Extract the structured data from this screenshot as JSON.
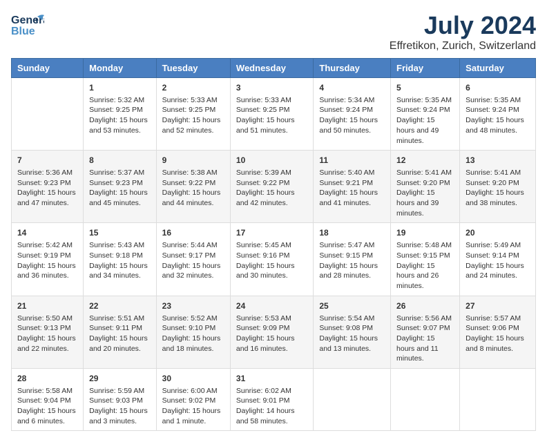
{
  "logo": {
    "line1": "General",
    "line2": "Blue"
  },
  "title": "July 2024",
  "subtitle": "Effretikon, Zurich, Switzerland",
  "days_of_week": [
    "Sunday",
    "Monday",
    "Tuesday",
    "Wednesday",
    "Thursday",
    "Friday",
    "Saturday"
  ],
  "weeks": [
    [
      {
        "day": "",
        "sunrise": "",
        "sunset": "",
        "daylight": ""
      },
      {
        "day": "1",
        "sunrise": "Sunrise: 5:32 AM",
        "sunset": "Sunset: 9:25 PM",
        "daylight": "Daylight: 15 hours and 53 minutes."
      },
      {
        "day": "2",
        "sunrise": "Sunrise: 5:33 AM",
        "sunset": "Sunset: 9:25 PM",
        "daylight": "Daylight: 15 hours and 52 minutes."
      },
      {
        "day": "3",
        "sunrise": "Sunrise: 5:33 AM",
        "sunset": "Sunset: 9:25 PM",
        "daylight": "Daylight: 15 hours and 51 minutes."
      },
      {
        "day": "4",
        "sunrise": "Sunrise: 5:34 AM",
        "sunset": "Sunset: 9:24 PM",
        "daylight": "Daylight: 15 hours and 50 minutes."
      },
      {
        "day": "5",
        "sunrise": "Sunrise: 5:35 AM",
        "sunset": "Sunset: 9:24 PM",
        "daylight": "Daylight: 15 hours and 49 minutes."
      },
      {
        "day": "6",
        "sunrise": "Sunrise: 5:35 AM",
        "sunset": "Sunset: 9:24 PM",
        "daylight": "Daylight: 15 hours and 48 minutes."
      }
    ],
    [
      {
        "day": "7",
        "sunrise": "Sunrise: 5:36 AM",
        "sunset": "Sunset: 9:23 PM",
        "daylight": "Daylight: 15 hours and 47 minutes."
      },
      {
        "day": "8",
        "sunrise": "Sunrise: 5:37 AM",
        "sunset": "Sunset: 9:23 PM",
        "daylight": "Daylight: 15 hours and 45 minutes."
      },
      {
        "day": "9",
        "sunrise": "Sunrise: 5:38 AM",
        "sunset": "Sunset: 9:22 PM",
        "daylight": "Daylight: 15 hours and 44 minutes."
      },
      {
        "day": "10",
        "sunrise": "Sunrise: 5:39 AM",
        "sunset": "Sunset: 9:22 PM",
        "daylight": "Daylight: 15 hours and 42 minutes."
      },
      {
        "day": "11",
        "sunrise": "Sunrise: 5:40 AM",
        "sunset": "Sunset: 9:21 PM",
        "daylight": "Daylight: 15 hours and 41 minutes."
      },
      {
        "day": "12",
        "sunrise": "Sunrise: 5:41 AM",
        "sunset": "Sunset: 9:20 PM",
        "daylight": "Daylight: 15 hours and 39 minutes."
      },
      {
        "day": "13",
        "sunrise": "Sunrise: 5:41 AM",
        "sunset": "Sunset: 9:20 PM",
        "daylight": "Daylight: 15 hours and 38 minutes."
      }
    ],
    [
      {
        "day": "14",
        "sunrise": "Sunrise: 5:42 AM",
        "sunset": "Sunset: 9:19 PM",
        "daylight": "Daylight: 15 hours and 36 minutes."
      },
      {
        "day": "15",
        "sunrise": "Sunrise: 5:43 AM",
        "sunset": "Sunset: 9:18 PM",
        "daylight": "Daylight: 15 hours and 34 minutes."
      },
      {
        "day": "16",
        "sunrise": "Sunrise: 5:44 AM",
        "sunset": "Sunset: 9:17 PM",
        "daylight": "Daylight: 15 hours and 32 minutes."
      },
      {
        "day": "17",
        "sunrise": "Sunrise: 5:45 AM",
        "sunset": "Sunset: 9:16 PM",
        "daylight": "Daylight: 15 hours and 30 minutes."
      },
      {
        "day": "18",
        "sunrise": "Sunrise: 5:47 AM",
        "sunset": "Sunset: 9:15 PM",
        "daylight": "Daylight: 15 hours and 28 minutes."
      },
      {
        "day": "19",
        "sunrise": "Sunrise: 5:48 AM",
        "sunset": "Sunset: 9:15 PM",
        "daylight": "Daylight: 15 hours and 26 minutes."
      },
      {
        "day": "20",
        "sunrise": "Sunrise: 5:49 AM",
        "sunset": "Sunset: 9:14 PM",
        "daylight": "Daylight: 15 hours and 24 minutes."
      }
    ],
    [
      {
        "day": "21",
        "sunrise": "Sunrise: 5:50 AM",
        "sunset": "Sunset: 9:13 PM",
        "daylight": "Daylight: 15 hours and 22 minutes."
      },
      {
        "day": "22",
        "sunrise": "Sunrise: 5:51 AM",
        "sunset": "Sunset: 9:11 PM",
        "daylight": "Daylight: 15 hours and 20 minutes."
      },
      {
        "day": "23",
        "sunrise": "Sunrise: 5:52 AM",
        "sunset": "Sunset: 9:10 PM",
        "daylight": "Daylight: 15 hours and 18 minutes."
      },
      {
        "day": "24",
        "sunrise": "Sunrise: 5:53 AM",
        "sunset": "Sunset: 9:09 PM",
        "daylight": "Daylight: 15 hours and 16 minutes."
      },
      {
        "day": "25",
        "sunrise": "Sunrise: 5:54 AM",
        "sunset": "Sunset: 9:08 PM",
        "daylight": "Daylight: 15 hours and 13 minutes."
      },
      {
        "day": "26",
        "sunrise": "Sunrise: 5:56 AM",
        "sunset": "Sunset: 9:07 PM",
        "daylight": "Daylight: 15 hours and 11 minutes."
      },
      {
        "day": "27",
        "sunrise": "Sunrise: 5:57 AM",
        "sunset": "Sunset: 9:06 PM",
        "daylight": "Daylight: 15 hours and 8 minutes."
      }
    ],
    [
      {
        "day": "28",
        "sunrise": "Sunrise: 5:58 AM",
        "sunset": "Sunset: 9:04 PM",
        "daylight": "Daylight: 15 hours and 6 minutes."
      },
      {
        "day": "29",
        "sunrise": "Sunrise: 5:59 AM",
        "sunset": "Sunset: 9:03 PM",
        "daylight": "Daylight: 15 hours and 3 minutes."
      },
      {
        "day": "30",
        "sunrise": "Sunrise: 6:00 AM",
        "sunset": "Sunset: 9:02 PM",
        "daylight": "Daylight: 15 hours and 1 minute."
      },
      {
        "day": "31",
        "sunrise": "Sunrise: 6:02 AM",
        "sunset": "Sunset: 9:01 PM",
        "daylight": "Daylight: 14 hours and 58 minutes."
      },
      {
        "day": "",
        "sunrise": "",
        "sunset": "",
        "daylight": ""
      },
      {
        "day": "",
        "sunrise": "",
        "sunset": "",
        "daylight": ""
      },
      {
        "day": "",
        "sunrise": "",
        "sunset": "",
        "daylight": ""
      }
    ]
  ]
}
